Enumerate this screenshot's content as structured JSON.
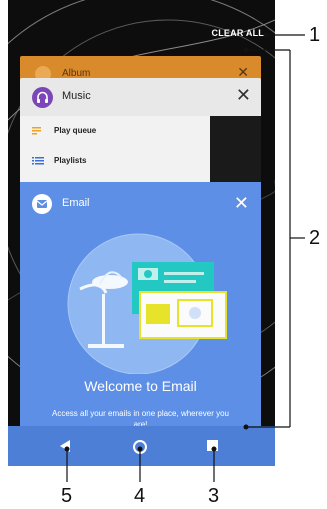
{
  "recents": {
    "clear_all": "CLEAR ALL",
    "cards": [
      {
        "app": "Album",
        "icon": "album-icon",
        "accent": "#d98a2b"
      },
      {
        "app": "Music",
        "icon": "music-icon",
        "accent": "#7b46b8",
        "items": [
          {
            "label": "Play queue",
            "icon": "play-queue-icon"
          },
          {
            "label": "Playlists",
            "icon": "playlists-icon"
          }
        ]
      },
      {
        "app": "Email",
        "icon": "email-icon",
        "accent": "#5d8fe6",
        "headline": "Welcome to Email",
        "description": "Access all your emails in one place, wherever you are!"
      }
    ]
  },
  "navbar": {
    "back_icon": "back-icon",
    "home_icon": "home-icon",
    "recent_icon": "recent-apps-icon"
  },
  "callouts": [
    "1",
    "2",
    "3",
    "4",
    "5"
  ]
}
